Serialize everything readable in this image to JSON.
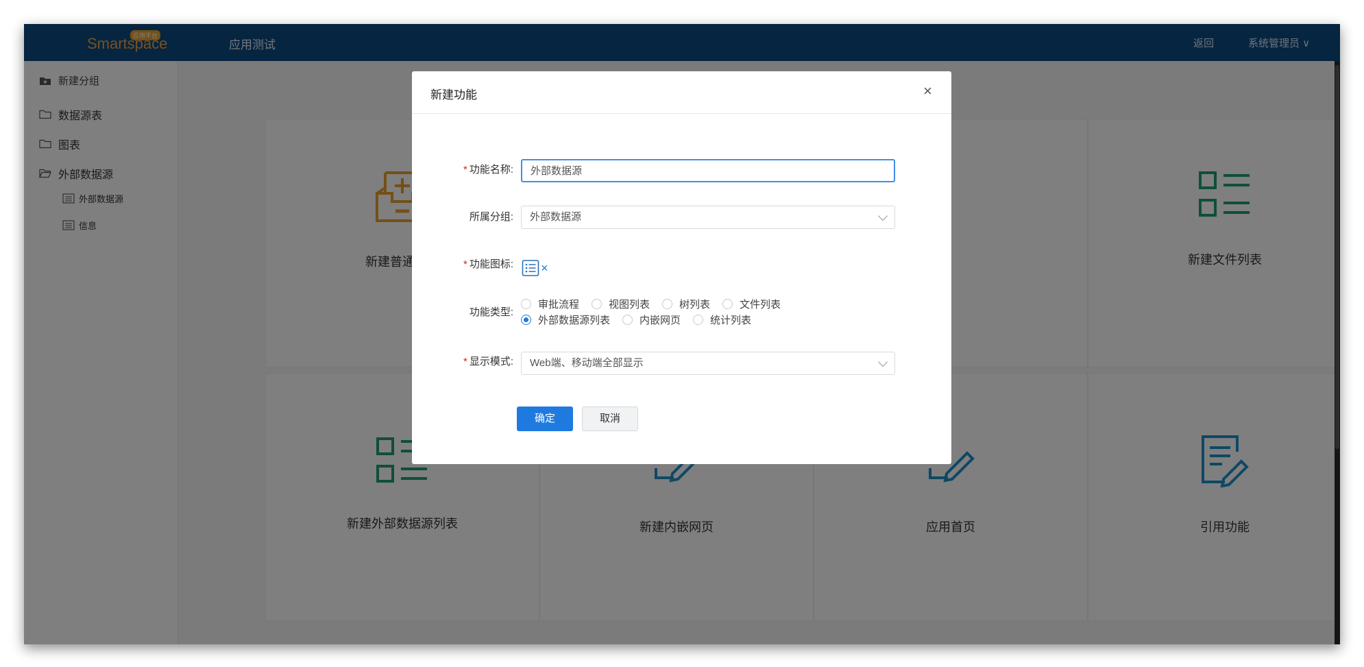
{
  "header": {
    "logo_text": "Smartspace",
    "logo_badge": "应用平台",
    "app_title": "应用测试",
    "back_label": "返回",
    "user_label": "系统管理员 ∨"
  },
  "sidebar": {
    "new_group_label": "新建分组",
    "items": [
      {
        "label": "数据源表"
      },
      {
        "label": "图表"
      },
      {
        "label": "外部数据源"
      }
    ],
    "subitems": [
      {
        "label": "外部数据源"
      },
      {
        "label": "信息"
      }
    ]
  },
  "cards": [
    {
      "label": "新建普通业务",
      "icon": "inbox-add-icon"
    },
    {
      "label": "新建文件列表",
      "icon": "list-icon"
    },
    {
      "label": "新建外部数据源列表",
      "icon": "list-icon"
    },
    {
      "label": "新建内嵌网页",
      "icon": "edit-icon"
    },
    {
      "label": "应用首页",
      "icon": "edit-icon"
    },
    {
      "label": "引用功能",
      "icon": "edit-doc-icon"
    }
  ],
  "dialog": {
    "title": "新建功能",
    "close_symbol": "×",
    "name_label": "功能名称:",
    "name_value": "外部数据源",
    "group_label": "所属分组:",
    "group_value": "外部数据源",
    "icon_label": "功能图标:",
    "icon_remove": "×",
    "type_label": "功能类型:",
    "type_options": [
      "审批流程",
      "视图列表",
      "树列表",
      "文件列表",
      "外部数据源列表",
      "内嵌网页",
      "统计列表"
    ],
    "type_selected": "外部数据源列表",
    "display_label": "显示模式:",
    "display_value": "Web端、移动端全部显示",
    "ok_label": "确定",
    "cancel_label": "取消"
  },
  "colors": {
    "topbar": "#0d4a82",
    "accent": "#1f7ae0",
    "orange_icon": "#e6a12e",
    "green_icon": "#1f9e6e",
    "blue_icon": "#1e90c8"
  }
}
